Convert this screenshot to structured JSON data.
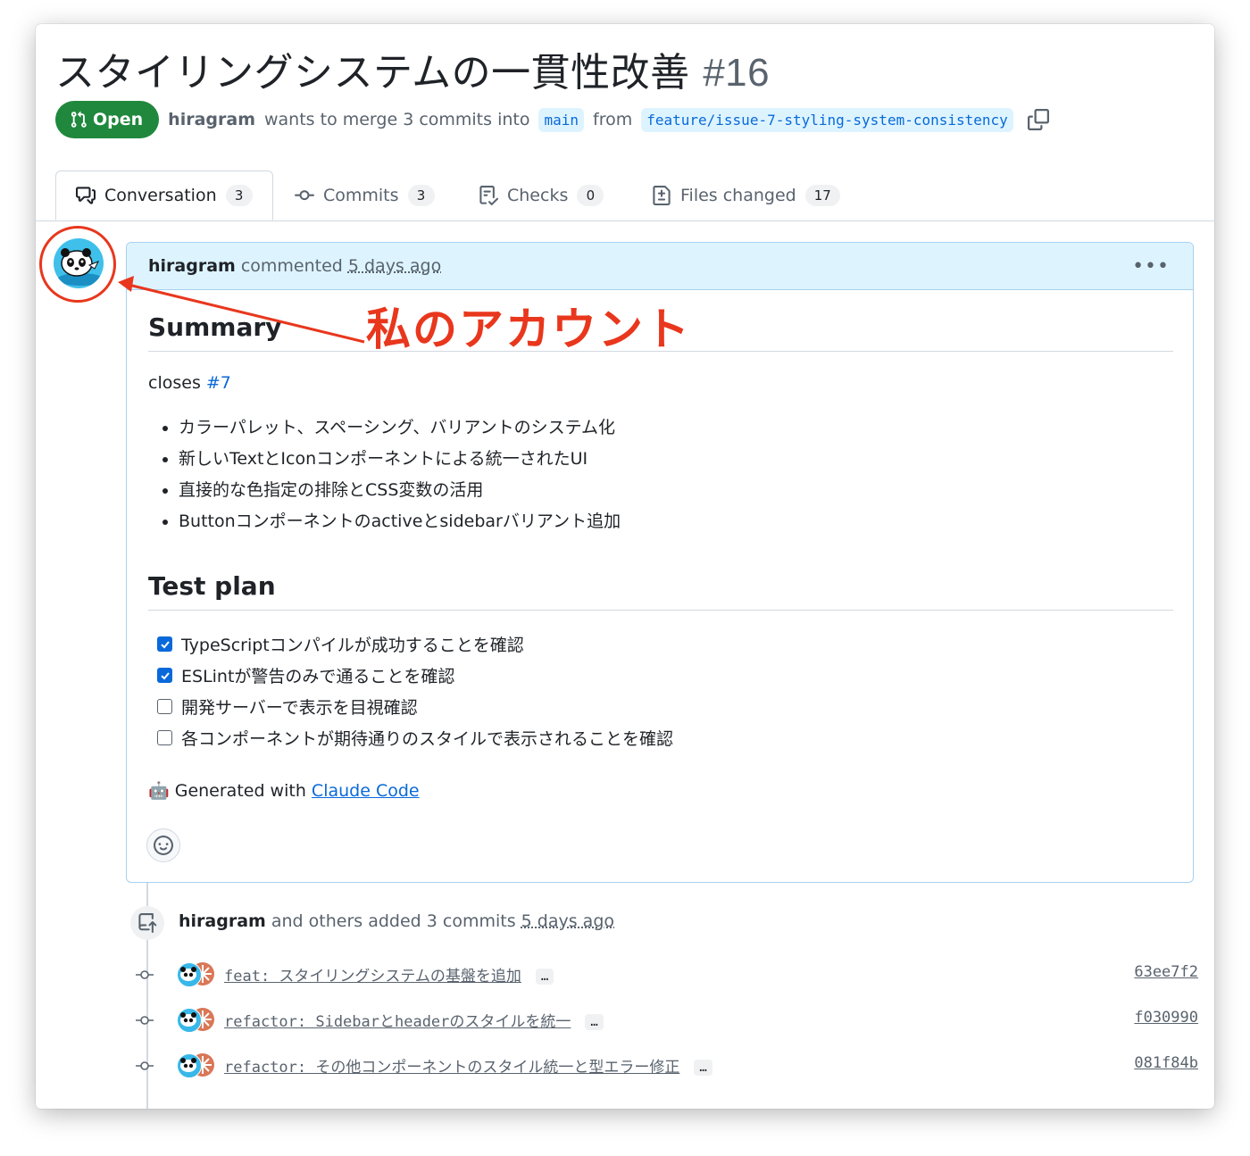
{
  "pr": {
    "title": "スタイリングシステムの一貫性改善",
    "number": "#16",
    "status": "Open",
    "author": "hiragram",
    "merge_text": "wants to merge 3 commits into",
    "base_branch": "main",
    "from_text": "from",
    "head_branch": "feature/issue-7-styling-system-consistency"
  },
  "tabs": [
    {
      "label": "Conversation",
      "count": "3",
      "icon": "comment-discussion-icon"
    },
    {
      "label": "Commits",
      "count": "3",
      "icon": "git-commit-icon"
    },
    {
      "label": "Checks",
      "count": "0",
      "icon": "checklist-icon"
    },
    {
      "label": "Files changed",
      "count": "17",
      "icon": "file-diff-icon"
    }
  ],
  "annotation": "私のアカウント",
  "comment": {
    "author": "hiragram",
    "action": "commented",
    "time": "5 days ago",
    "summary_heading": "Summary",
    "closes_text": "closes",
    "closes_link": "#7",
    "bullets": [
      "カラーパレット、スペーシング、バリアントのシステム化",
      "新しいTextとIconコンポーネントによる統一されたUI",
      "直接的な色指定の排除とCSS変数の活用",
      "Buttonコンポーネントのactiveとsidebarバリアント追加"
    ],
    "test_heading": "Test plan",
    "tasks": [
      {
        "text": "TypeScriptコンパイルが成功することを確認",
        "checked": true
      },
      {
        "text": "ESLintが警告のみで通ることを確認",
        "checked": true
      },
      {
        "text": "開発サーバーで表示を目視確認",
        "checked": false
      },
      {
        "text": "各コンポーネントが期待通りのスタイルで表示されることを確認",
        "checked": false
      }
    ],
    "generated_emoji": "🤖",
    "generated_text": "Generated with",
    "generated_link": "Claude Code"
  },
  "timeline": {
    "author": "hiragram",
    "text": "and others added 3 commits",
    "time": "5 days ago",
    "commits": [
      {
        "message": "feat: スタイリングシステムの基盤を追加",
        "sha": "63ee7f2"
      },
      {
        "message": "refactor: Sidebarとheaderのスタイルを統一",
        "sha": "f030990"
      },
      {
        "message": "refactor: その他コンポーネントのスタイル統一と型エラー修正",
        "sha": "081f84b"
      }
    ],
    "more_label": "…"
  },
  "colors": {
    "open_green": "#1f883d",
    "link_blue": "#0969da",
    "annotation_red": "#e8371d",
    "comment_header_bg": "#ddf4ff"
  }
}
